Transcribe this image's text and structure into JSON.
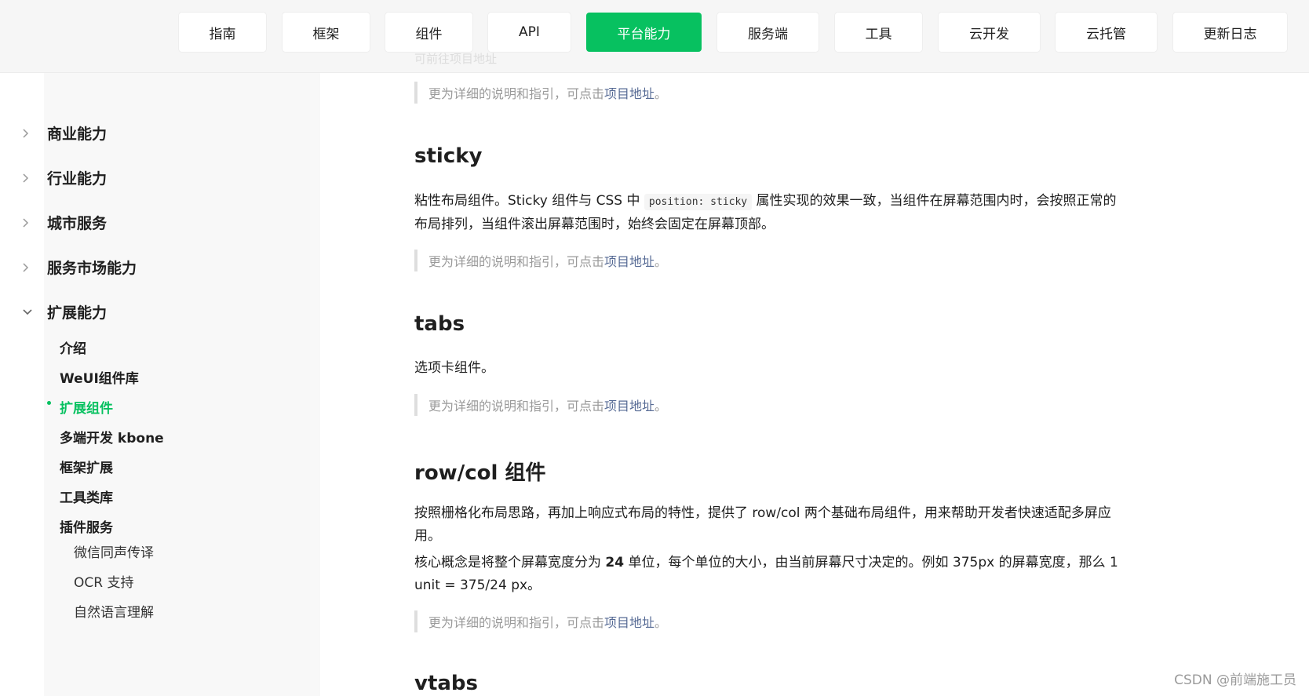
{
  "nav": {
    "items": [
      "指南",
      "框架",
      "组件",
      "API",
      "平台能力",
      "服务端",
      "工具",
      "云开发",
      "云托管",
      "更新日志"
    ],
    "active": "平台能力"
  },
  "header_ghost_text": "可前往项目地址",
  "sidebar": {
    "sections": [
      "商业能力",
      "行业能力",
      "城市服务",
      "服务市场能力",
      "扩展能力"
    ],
    "subitems": [
      "介绍",
      "WeUI组件库",
      "扩展组件",
      "多端开发 kbone",
      "框架扩展",
      "工具类库",
      "插件服务"
    ],
    "plugin_items": [
      "微信同声传译",
      "OCR 支持",
      "自然语言理解"
    ]
  },
  "content": {
    "note_prefix": "更为详细的说明和指引，可点击",
    "note_link": "项目地址",
    "note_suffix": "。",
    "sticky": {
      "title": "sticky",
      "text_before_code": "粘性布局组件。Sticky 组件与 CSS 中 ",
      "code": "position: sticky",
      "text_after_code": " 属性实现的效果一致，当组件在屏幕范围内时，会按照正常的布局排列，当组件滚出屏幕范围时，始终会固定在屏幕顶部。"
    },
    "tabs": {
      "title": "tabs",
      "text": "选项卡组件。"
    },
    "rowcol": {
      "title": "row/col 组件",
      "text1": "按照栅格化布局思路，再加上响应式布局的特性，提供了 row/col 两个基础布局组件，用来帮助开发者快速适配多屏应用。",
      "text2_a": "核心概念是将整个屏幕宽度分为 ",
      "text2_bold": "24",
      "text2_b": " 单位，每个单位的大小，由当前屏幕尺寸决定的。例如 375px 的屏幕宽度，那么 1 unit = 375/24 px。"
    },
    "vtabs": {
      "title": "vtabs"
    }
  },
  "watermark": "CSDN @前端施工员",
  "colors": {
    "accent": "#07c160",
    "link": "#576b95"
  }
}
